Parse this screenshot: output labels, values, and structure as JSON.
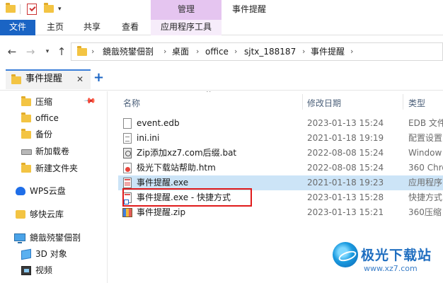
{
  "window": {
    "title": "事件提醒",
    "context_tab": "管理"
  },
  "ribbon": {
    "tabs": [
      "文件",
      "主页",
      "共享",
      "查看",
      "应用程序工具"
    ]
  },
  "address": {
    "crumbs": [
      "鏡戠殑鐢佃剳",
      "桌面",
      "office",
      "sjtx_188187",
      "事件提醒"
    ]
  },
  "tab": {
    "label": "事件提醒",
    "close": "✕",
    "new": "+"
  },
  "nav": {
    "items": [
      {
        "label": "压缩",
        "icon": "folder-icon",
        "pinned": true
      },
      {
        "label": "office",
        "icon": "folder-icon"
      },
      {
        "label": "备份",
        "icon": "folder-icon"
      },
      {
        "label": "新加载卷",
        "icon": "drive-icon"
      },
      {
        "label": "新建文件夹",
        "icon": "folder-icon"
      },
      {
        "label": "WPS云盘",
        "icon": "wps-cloud-icon"
      },
      {
        "label": "够快云库",
        "icon": "cloud-library-icon"
      },
      {
        "label": "鏡戠殑鐢佃剳",
        "icon": "computer-icon"
      },
      {
        "label": "3D 对象",
        "icon": "3d-objects-icon"
      },
      {
        "label": "视频",
        "icon": "video-icon"
      }
    ]
  },
  "columns": {
    "name": "名称",
    "date": "修改日期",
    "type": "类型"
  },
  "files": [
    {
      "name": "event.edb",
      "date": "2023-01-13 15:24",
      "type": "EDB 文件",
      "icon": "doc"
    },
    {
      "name": "ini.ini",
      "date": "2021-01-18 19:19",
      "type": "配置设置",
      "icon": "ini"
    },
    {
      "name": "Zip添加xz7.com后缀.bat",
      "date": "2022-08-08 15:24",
      "type": "Window",
      "icon": "bat"
    },
    {
      "name": "极光下载站帮助.htm",
      "date": "2022-08-08 15:24",
      "type": "360 Chro",
      "icon": "htm"
    },
    {
      "name": "事件提醒.exe",
      "date": "2021-01-18 19:23",
      "type": "应用程序",
      "icon": "exe",
      "selected": true
    },
    {
      "name": "事件提醒.exe - 快捷方式",
      "date": "2023-01-13 15:28",
      "type": "快捷方式",
      "icon": "lnk"
    },
    {
      "name": "事件提醒.zip",
      "date": "2023-01-13 15:21",
      "type": "360压缩",
      "icon": "zip"
    }
  ],
  "watermark": {
    "name": "极光下载站",
    "url": "www.xz7.com"
  },
  "colors": {
    "accent": "#1a64c4",
    "selection": "#cce4f7",
    "manage_tab": "#e5c5f0",
    "highlight_box": "#e01b1b"
  }
}
